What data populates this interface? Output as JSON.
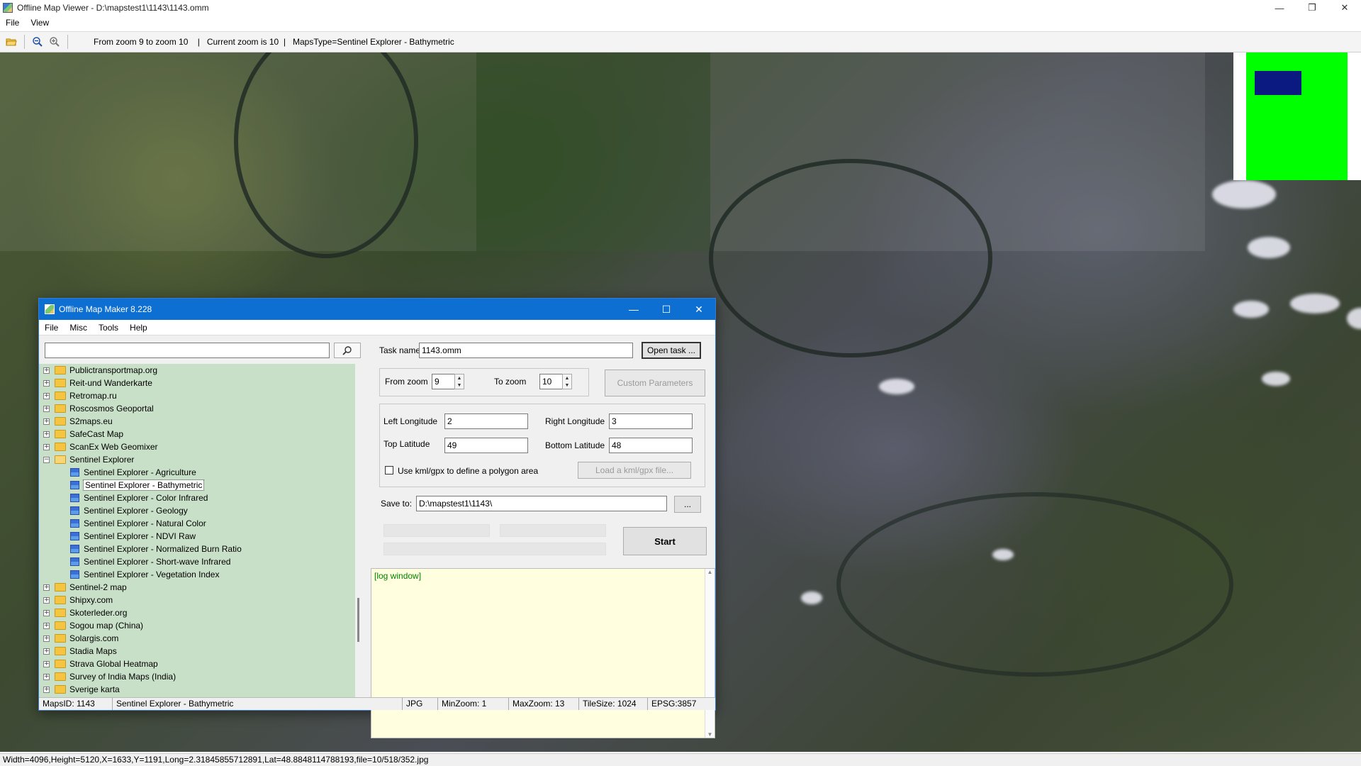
{
  "app": {
    "title": "Offline Map Viewer - D:\\mapstest1\\1143\\1143.omm",
    "menu": [
      "File",
      "View"
    ],
    "controls": {
      "minimize": "—",
      "restore": "❐",
      "close": "✕"
    }
  },
  "toolbar": {
    "info": "From zoom 9 to zoom 10    |   Current zoom is 10  |   MapsType=Sentinel Explorer - Bathymetric",
    "icons": [
      "folder-open-icon",
      "zoom-out-icon",
      "zoom-in-icon"
    ]
  },
  "statusbar": {
    "text": "Width=4096,Height=5120,X=1633,Y=1191,Long=2.31845855712891,Lat=48.8848114788193,file=10/518/352.jpg"
  },
  "dialog": {
    "title": "Offline Map Maker 8.228",
    "menu": [
      "File",
      "Misc",
      "Tools",
      "Help"
    ],
    "controls": {
      "minimize": "—",
      "maximize": "☐",
      "close": "✕"
    },
    "search": {
      "value": "",
      "placeholder": ""
    },
    "tree": {
      "items": [
        {
          "label": "Publictransportmap.org",
          "type": "folder",
          "expander": "+"
        },
        {
          "label": "Reit-und Wanderkarte",
          "type": "folder",
          "expander": "+"
        },
        {
          "label": "Retromap.ru",
          "type": "folder",
          "expander": "+"
        },
        {
          "label": "Roscosmos Geoportal",
          "type": "folder",
          "expander": "+"
        },
        {
          "label": "S2maps.eu",
          "type": "folder",
          "expander": "+"
        },
        {
          "label": "SafeCast Map",
          "type": "folder",
          "expander": "+"
        },
        {
          "label": "ScanEx Web Geomixer",
          "type": "folder",
          "expander": "+"
        },
        {
          "label": "Sentinel Explorer",
          "type": "folder-open",
          "expander": "−"
        },
        {
          "label": "Sentinel Explorer - Agriculture",
          "type": "map"
        },
        {
          "label": "Sentinel Explorer - Bathymetric",
          "type": "map",
          "selected": true
        },
        {
          "label": "Sentinel Explorer - Color Infrared",
          "type": "map"
        },
        {
          "label": "Sentinel Explorer - Geology",
          "type": "map"
        },
        {
          "label": "Sentinel Explorer - Natural Color",
          "type": "map"
        },
        {
          "label": "Sentinel Explorer - NDVI Raw",
          "type": "map"
        },
        {
          "label": "Sentinel Explorer - Normalized Burn Ratio",
          "type": "map"
        },
        {
          "label": "Sentinel Explorer - Short-wave Infrared",
          "type": "map"
        },
        {
          "label": "Sentinel Explorer - Vegetation Index",
          "type": "map"
        },
        {
          "label": "Sentinel-2 map",
          "type": "folder",
          "expander": "+"
        },
        {
          "label": "Shipxy.com",
          "type": "folder",
          "expander": "+"
        },
        {
          "label": "Skoterleder.org",
          "type": "folder",
          "expander": "+"
        },
        {
          "label": "Sogou map (China)",
          "type": "folder",
          "expander": "+"
        },
        {
          "label": "Solargis.com",
          "type": "folder",
          "expander": "+"
        },
        {
          "label": "Stadia Maps",
          "type": "folder",
          "expander": "+"
        },
        {
          "label": "Strava Global Heatmap",
          "type": "folder",
          "expander": "+"
        },
        {
          "label": "Survey of India Maps (India)",
          "type": "folder",
          "expander": "+"
        },
        {
          "label": "Sverige karta",
          "type": "folder",
          "expander": "+"
        }
      ]
    },
    "form": {
      "task_name_label": "Task name",
      "task_name_value": "1143.omm",
      "open_task_label": "Open task ...",
      "from_zoom_label": "From zoom",
      "from_zoom_value": "9",
      "to_zoom_label": "To zoom",
      "to_zoom_value": "10",
      "custom_params_label": "Custom Parameters",
      "left_lon_label": "Left Longitude",
      "left_lon_value": "2",
      "right_lon_label": "Right Longitude",
      "right_lon_value": "3",
      "top_lat_label": "Top Latitude",
      "top_lat_value": "49",
      "bottom_lat_label": "Bottom Latitude",
      "bottom_lat_value": "48",
      "kml_checkbox_label": "Use kml/gpx to define a polygon area",
      "load_kml_label": "Load a kml/gpx file...",
      "save_to_label": "Save to:",
      "save_to_value": "D:\\mapstest1\\1143\\",
      "browse_label": "...",
      "start_label": "Start"
    },
    "log": {
      "text": "[log window]"
    },
    "status": {
      "maps_id": "MapsID: 1143",
      "maps_name": "Sentinel Explorer - Bathymetric",
      "format": "JPG",
      "min_zoom": "MinZoom: 1",
      "max_zoom": "MaxZoom: 13",
      "tile_size": "TileSize: 1024",
      "epsg": "EPSG:3857"
    }
  },
  "colors": {
    "dialog_title_bg": "#0c6fd1",
    "tree_bg": "#c8dfc8",
    "log_bg": "#ffffe0",
    "log_text": "#008000",
    "minimap_area": "#00ff00",
    "minimap_viewport": "#0a1a80"
  }
}
